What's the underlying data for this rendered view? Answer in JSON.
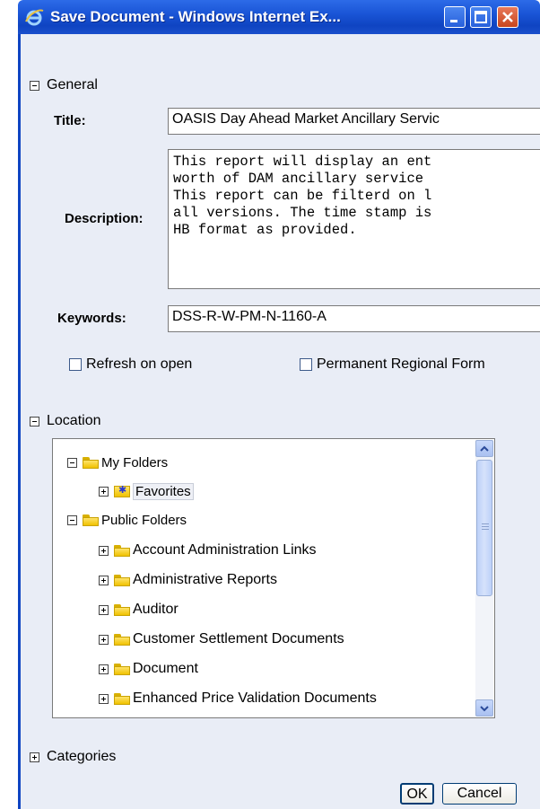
{
  "window": {
    "title": "Save Document - Windows Internet Ex..."
  },
  "general": {
    "header": "General",
    "title_label": "Title:",
    "title_value": "OASIS Day Ahead Market Ancillary Servic",
    "description_label": "Description:",
    "description_value": "This report will display an ent\nworth of DAM ancillary service\nThis report can be filterd on l\nall versions. The time stamp is\nHB format as provided.",
    "keywords_label": "Keywords:",
    "keywords_value": "DSS-R-W-PM-N-1160-A",
    "refresh_label": "Refresh on open",
    "regional_label": "Permanent Regional Form"
  },
  "location": {
    "header": "Location",
    "my_folders": "My Folders",
    "favorites": "Favorites",
    "public_folders": "Public Folders",
    "public_items": [
      "Account Administration Links",
      "Administrative Reports",
      "Auditor",
      "Customer Settlement Documents",
      "Document",
      "Enhanced Price Validation Documents"
    ]
  },
  "categories": {
    "header": "Categories"
  },
  "buttons": {
    "ok": "OK",
    "cancel": "Cancel"
  },
  "colors": {
    "titlebar": "#1a55d6",
    "body": "#e9edf6"
  }
}
